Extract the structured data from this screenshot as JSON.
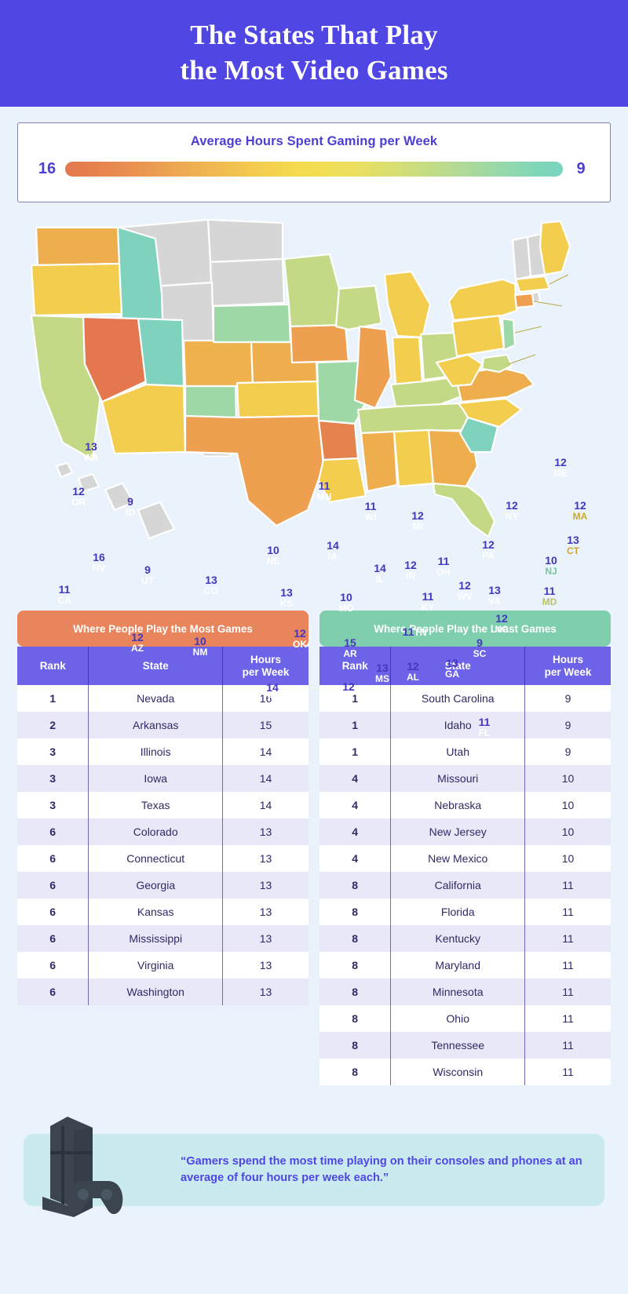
{
  "header": {
    "title_line1": "The States That Play",
    "title_line2": "the Most Video Games",
    "bg_color": "#5046E4"
  },
  "legend": {
    "title": "Average Hours Spent Gaming per Week",
    "max_label": "16",
    "min_label": "9",
    "gradient_start_color": "#e4774e",
    "gradient_mid_color": "#f5dc4e",
    "gradient_end_color": "#76d4bf"
  },
  "map": {
    "no_data_color": "#D6D6D6",
    "states": [
      {
        "abbr": "WA",
        "value": "13"
      },
      {
        "abbr": "OR",
        "value": "12"
      },
      {
        "abbr": "ID",
        "value": "9"
      },
      {
        "abbr": "NV",
        "value": "16"
      },
      {
        "abbr": "UT",
        "value": "9"
      },
      {
        "abbr": "CA",
        "value": "11"
      },
      {
        "abbr": "AZ",
        "value": "12"
      },
      {
        "abbr": "NM",
        "value": "10"
      },
      {
        "abbr": "CO",
        "value": "13"
      },
      {
        "abbr": "NE",
        "value": "10"
      },
      {
        "abbr": "KS",
        "value": "13"
      },
      {
        "abbr": "OK",
        "value": "12"
      },
      {
        "abbr": "TX",
        "value": "14"
      },
      {
        "abbr": "MN",
        "value": "11"
      },
      {
        "abbr": "IA",
        "value": "14"
      },
      {
        "abbr": "MO",
        "value": "10"
      },
      {
        "abbr": "AR",
        "value": "15"
      },
      {
        "abbr": "LA",
        "value": "12"
      },
      {
        "abbr": "WI",
        "value": "11"
      },
      {
        "abbr": "IL",
        "value": "14"
      },
      {
        "abbr": "MI",
        "value": "12"
      },
      {
        "abbr": "IN",
        "value": "12"
      },
      {
        "abbr": "OH",
        "value": "11"
      },
      {
        "abbr": "KY",
        "value": "11"
      },
      {
        "abbr": "TN",
        "value": "11"
      },
      {
        "abbr": "MS",
        "value": "13"
      },
      {
        "abbr": "AL",
        "value": "12"
      },
      {
        "abbr": "GA",
        "value": "13"
      },
      {
        "abbr": "FL",
        "value": "11"
      },
      {
        "abbr": "SC",
        "value": "9"
      },
      {
        "abbr": "NC",
        "value": "12"
      },
      {
        "abbr": "VA",
        "value": "13"
      },
      {
        "abbr": "WV",
        "value": "12"
      },
      {
        "abbr": "PA",
        "value": "12"
      },
      {
        "abbr": "NY",
        "value": "12"
      },
      {
        "abbr": "ME",
        "value": "12"
      },
      {
        "abbr": "MA",
        "value": "12"
      },
      {
        "abbr": "CT",
        "value": "13"
      },
      {
        "abbr": "NJ",
        "value": "10"
      },
      {
        "abbr": "MD",
        "value": "11"
      }
    ]
  },
  "tables": {
    "most": {
      "banner": "Where People Play the Most Games",
      "banner_color": "#E8855C",
      "columns": [
        "Rank",
        "State",
        "Hours\nper Week"
      ],
      "col_rank": "Rank",
      "col_state": "State",
      "col_hours_l1": "Hours",
      "col_hours_l2": "per Week",
      "rows": [
        {
          "rank": "1",
          "state": "Nevada",
          "hours": "16"
        },
        {
          "rank": "2",
          "state": "Arkansas",
          "hours": "15"
        },
        {
          "rank": "3",
          "state": "Illinois",
          "hours": "14"
        },
        {
          "rank": "3",
          "state": "Iowa",
          "hours": "14"
        },
        {
          "rank": "3",
          "state": "Texas",
          "hours": "14"
        },
        {
          "rank": "6",
          "state": "Colorado",
          "hours": "13"
        },
        {
          "rank": "6",
          "state": "Connecticut",
          "hours": "13"
        },
        {
          "rank": "6",
          "state": "Georgia",
          "hours": "13"
        },
        {
          "rank": "6",
          "state": "Kansas",
          "hours": "13"
        },
        {
          "rank": "6",
          "state": "Mississippi",
          "hours": "13"
        },
        {
          "rank": "6",
          "state": "Virginia",
          "hours": "13"
        },
        {
          "rank": "6",
          "state": "Washington",
          "hours": "13"
        }
      ]
    },
    "least": {
      "banner": "Where People Play the Least Games",
      "banner_color": "#7FCFAE",
      "col_rank": "Rank",
      "col_state": "State",
      "col_hours_l1": "Hours",
      "col_hours_l2": "per Week",
      "rows": [
        {
          "rank": "1",
          "state": "South Carolina",
          "hours": "9"
        },
        {
          "rank": "1",
          "state": "Idaho",
          "hours": "9"
        },
        {
          "rank": "1",
          "state": "Utah",
          "hours": "9"
        },
        {
          "rank": "4",
          "state": "Missouri",
          "hours": "10"
        },
        {
          "rank": "4",
          "state": "Nebraska",
          "hours": "10"
        },
        {
          "rank": "4",
          "state": "New Jersey",
          "hours": "10"
        },
        {
          "rank": "4",
          "state": "New Mexico",
          "hours": "10"
        },
        {
          "rank": "8",
          "state": "California",
          "hours": "11"
        },
        {
          "rank": "8",
          "state": "Florida",
          "hours": "11"
        },
        {
          "rank": "8",
          "state": "Kentucky",
          "hours": "11"
        },
        {
          "rank": "8",
          "state": "Maryland",
          "hours": "11"
        },
        {
          "rank": "8",
          "state": "Minnesota",
          "hours": "11"
        },
        {
          "rank": "8",
          "state": "Ohio",
          "hours": "11"
        },
        {
          "rank": "8",
          "state": "Tennessee",
          "hours": "11"
        },
        {
          "rank": "8",
          "state": "Wisconsin",
          "hours": "11"
        }
      ]
    }
  },
  "footer": {
    "quote": "“Gamers spend the most time playing on their consoles and phones at an average of four hours per week each.”",
    "quote_bg": "#C9EAEF",
    "quote_color": "#5046E4"
  },
  "chart_data": {
    "type": "heatmap",
    "title": "The States That Play the Most Video Games",
    "subtitle": "Average Hours Spent Gaming per Week",
    "unit": "hours per week",
    "value_range": [
      9,
      16
    ],
    "colorbar": {
      "high": 16,
      "low": 9,
      "high_color": "#e4774e",
      "low_color": "#76d4bf"
    },
    "categories": [
      "WA",
      "OR",
      "ID",
      "NV",
      "UT",
      "CA",
      "AZ",
      "NM",
      "CO",
      "NE",
      "KS",
      "OK",
      "TX",
      "MN",
      "IA",
      "MO",
      "AR",
      "LA",
      "WI",
      "IL",
      "MI",
      "IN",
      "OH",
      "KY",
      "TN",
      "MS",
      "AL",
      "GA",
      "FL",
      "SC",
      "NC",
      "VA",
      "WV",
      "PA",
      "NY",
      "ME",
      "MA",
      "CT",
      "NJ",
      "MD"
    ],
    "values": [
      13,
      12,
      9,
      16,
      9,
      11,
      12,
      10,
      13,
      10,
      13,
      12,
      14,
      11,
      14,
      10,
      15,
      12,
      11,
      14,
      12,
      12,
      11,
      11,
      11,
      13,
      12,
      13,
      11,
      9,
      12,
      13,
      12,
      12,
      12,
      12,
      12,
      13,
      10,
      11
    ],
    "no_data_states": [
      "AK",
      "HI",
      "MT",
      "WY",
      "ND",
      "SD",
      "VT",
      "NH",
      "RI",
      "DE"
    ]
  }
}
